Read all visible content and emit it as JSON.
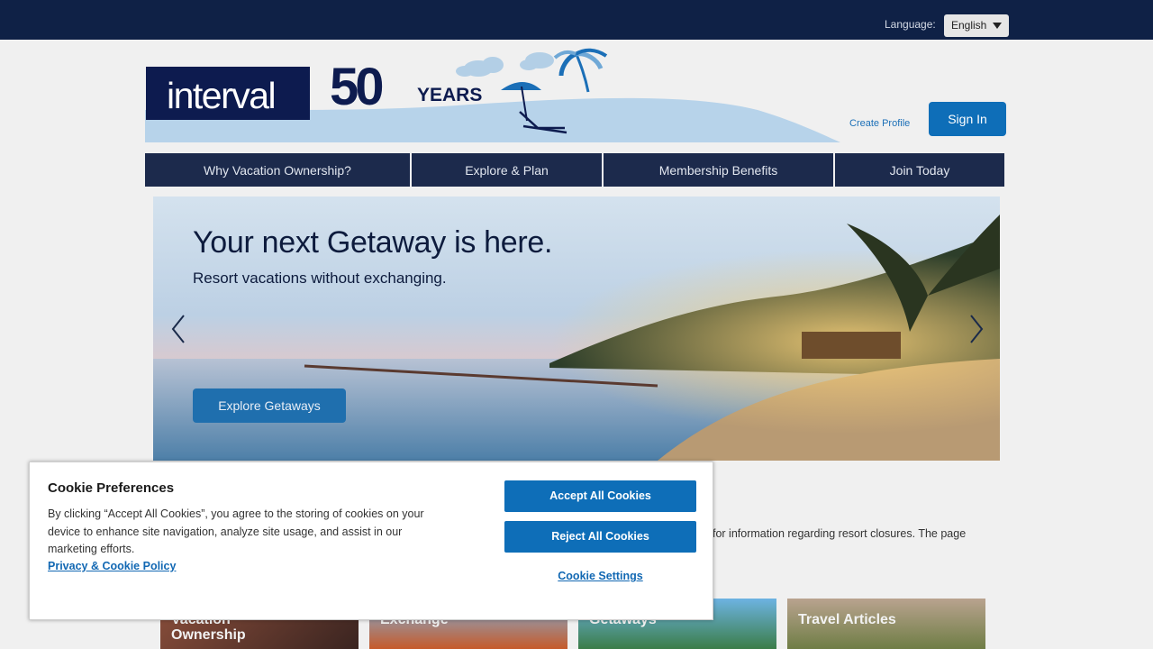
{
  "topbar": {
    "language_label": "Language:",
    "language_value": "English"
  },
  "header": {
    "logo_text": "interval",
    "anniversary_number": "50",
    "anniversary_word": "YEARS",
    "create_profile": "Create Profile",
    "sign_in": "Sign In"
  },
  "nav": {
    "items": [
      {
        "label": "Why Vacation Ownership?"
      },
      {
        "label": "Explore & Plan"
      },
      {
        "label": "Membership Benefits"
      },
      {
        "label": "Join Today"
      }
    ]
  },
  "hero": {
    "title": "Your next Getaway is here.",
    "subtitle": "Resort vacations without exchanging.",
    "button": "Explore Getaways"
  },
  "main": {
    "notice_fragment": "for information regarding resort closures. The page",
    "tiles": [
      {
        "label_line1": "Vacation",
        "label_line2": "Ownership"
      },
      {
        "label_line1": "Exchange",
        "label_line2": ""
      },
      {
        "label_line1": "Getaways",
        "label_line2": ""
      },
      {
        "label_line1": "Travel Articles",
        "label_line2": ""
      }
    ]
  },
  "cookie": {
    "title": "Cookie Preferences",
    "text": "By clicking “Accept All Cookies”, you agree to the storing of cookies on your device to enhance site navigation, analyze site usage, and assist in our marketing efforts.",
    "policy_link": "Privacy & Cookie Policy",
    "accept": "Accept All Cookies",
    "reject": "Reject All Cookies",
    "settings": "Cookie Settings"
  },
  "colors": {
    "topbar": "#0f2146",
    "brand_navy": "#0d1b4f",
    "button_blue": "#0e6eb8",
    "nav_bg": "#1c2a4c"
  }
}
